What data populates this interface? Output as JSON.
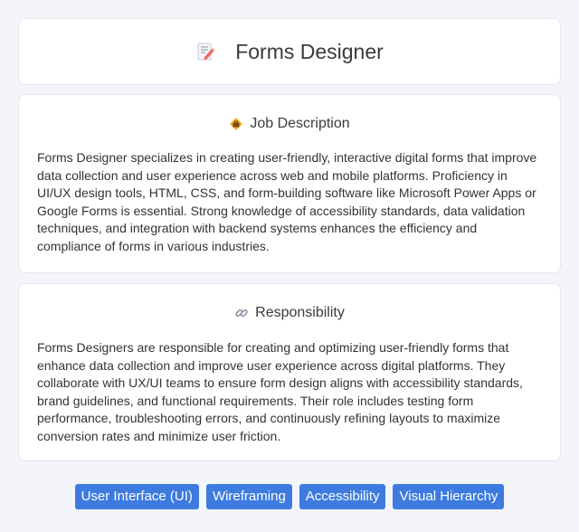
{
  "header": {
    "title": "Forms Designer",
    "icon": "memo-icon"
  },
  "job_description": {
    "heading": "Job Description",
    "icon": "briefcase-icon",
    "body": "Forms Designer specializes in creating user-friendly, interactive digital forms that improve data collection and user experience across web and mobile platforms. Proficiency in UI/UX design tools, HTML, CSS, and form-building software like Microsoft Power Apps or Google Forms is essential. Strong knowledge of accessibility standards, data validation techniques, and integration with backend systems enhances the efficiency and compliance of forms in various industries."
  },
  "responsibility": {
    "heading": "Responsibility",
    "icon": "link-icon",
    "body": "Forms Designers are responsible for creating and optimizing user-friendly forms that enhance data collection and improve user experience across digital platforms. They collaborate with UX/UI teams to ensure form design aligns with accessibility standards, brand guidelines, and functional requirements. Their role includes testing form performance, troubleshooting errors, and continuously refining layouts to maximize conversion rates and minimize user friction."
  },
  "tags": [
    "User Interface (UI)",
    "Wireframing",
    "Accessibility",
    "Visual Hierarchy"
  ],
  "colors": {
    "tag_background": "#3d7be0",
    "page_background": "#f3f5fb"
  }
}
